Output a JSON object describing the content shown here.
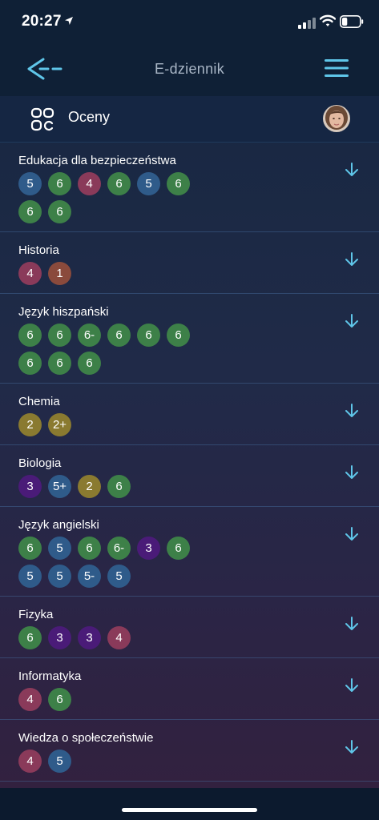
{
  "status_bar": {
    "time": "20:27",
    "battery_level": 0.3
  },
  "nav": {
    "title": "E-dziennik"
  },
  "section": {
    "title": "Oceny"
  },
  "grade_colors": {
    "green": "#3d8048",
    "blue": "#2f5b8a",
    "magenta": "#8a3a5a",
    "brown": "#8a4a3c",
    "olive": "#8a7a30",
    "purple": "#4a1b78"
  },
  "subjects": [
    {
      "name": "Edukacja dla bezpieczeństwa",
      "grades": [
        {
          "v": "5",
          "c": "blue"
        },
        {
          "v": "6",
          "c": "green"
        },
        {
          "v": "4",
          "c": "magenta"
        },
        {
          "v": "6",
          "c": "green"
        },
        {
          "v": "5",
          "c": "blue"
        },
        {
          "v": "6",
          "c": "green"
        },
        {
          "v": "6",
          "c": "green"
        },
        {
          "v": "6",
          "c": "green"
        }
      ]
    },
    {
      "name": "Historia",
      "grades": [
        {
          "v": "4",
          "c": "magenta"
        },
        {
          "v": "1",
          "c": "brown"
        }
      ]
    },
    {
      "name": "Język hiszpański",
      "grades": [
        {
          "v": "6",
          "c": "green"
        },
        {
          "v": "6",
          "c": "green"
        },
        {
          "v": "6-",
          "c": "green"
        },
        {
          "v": "6",
          "c": "green"
        },
        {
          "v": "6",
          "c": "green"
        },
        {
          "v": "6",
          "c": "green"
        },
        {
          "v": "6",
          "c": "green"
        },
        {
          "v": "6",
          "c": "green"
        },
        {
          "v": "6",
          "c": "green"
        }
      ]
    },
    {
      "name": "Chemia",
      "grades": [
        {
          "v": "2",
          "c": "olive"
        },
        {
          "v": "2+",
          "c": "olive"
        }
      ]
    },
    {
      "name": "Biologia",
      "grades": [
        {
          "v": "3",
          "c": "purple"
        },
        {
          "v": "5+",
          "c": "blue"
        },
        {
          "v": "2",
          "c": "olive"
        },
        {
          "v": "6",
          "c": "green"
        }
      ]
    },
    {
      "name": "Język angielski",
      "grades": [
        {
          "v": "6",
          "c": "green"
        },
        {
          "v": "5",
          "c": "blue"
        },
        {
          "v": "6",
          "c": "green"
        },
        {
          "v": "6-",
          "c": "green"
        },
        {
          "v": "3",
          "c": "purple"
        },
        {
          "v": "6",
          "c": "green"
        },
        {
          "v": "5",
          "c": "blue"
        },
        {
          "v": "5",
          "c": "blue"
        },
        {
          "v": "5-",
          "c": "blue"
        },
        {
          "v": "5",
          "c": "blue"
        }
      ]
    },
    {
      "name": "Fizyka",
      "grades": [
        {
          "v": "6",
          "c": "green"
        },
        {
          "v": "3",
          "c": "purple"
        },
        {
          "v": "3",
          "c": "purple"
        },
        {
          "v": "4",
          "c": "magenta"
        }
      ]
    },
    {
      "name": "Informatyka",
      "grades": [
        {
          "v": "4",
          "c": "magenta"
        },
        {
          "v": "6",
          "c": "green"
        }
      ]
    },
    {
      "name": "Wiedza o społeczeństwie",
      "grades": [
        {
          "v": "4",
          "c": "magenta"
        },
        {
          "v": "5",
          "c": "blue"
        }
      ]
    }
  ]
}
